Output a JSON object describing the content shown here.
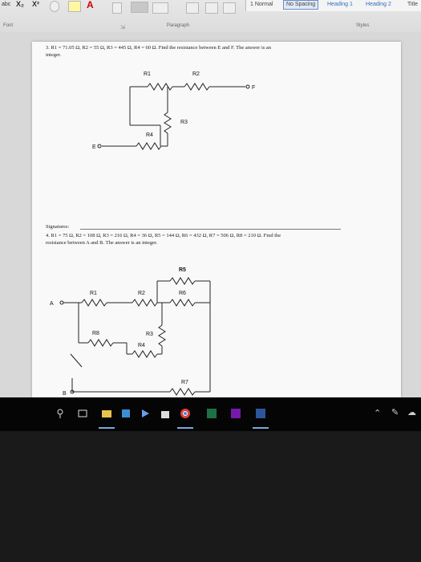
{
  "ribbon": {
    "row_left": [
      "abc",
      "X₂",
      "X²"
    ],
    "font_group": "Font",
    "paragraph_group": "Paragraph",
    "styles_group": "Styles",
    "styles": [
      "1 Normal",
      "No Spacing",
      "Heading 1",
      "Heading 2",
      "Title"
    ]
  },
  "doc": {
    "q3_line1": "3. R1 = 71.05 Ω, R2 = 55 Ω, R3 = 445 Ω, R4 = 60 Ω. Find the resistance between E and F. The answer is an",
    "q3_line2": "integer.",
    "c1": {
      "r1": "R1",
      "r2": "R2",
      "r3": "R3",
      "r4": "R4",
      "e": "E",
      "f": "F"
    },
    "signatures": "Signatures:",
    "q4_line1": "4. R1 = 75 Ω, R2 = 108 Ω, R3 = 216 Ω, R4 = 36 Ω, R5 = 144 Ω, R6 = 432 Ω, R7 = 506 Ω, R8 = 210 Ω. Find the",
    "q4_line2": "resistance between A and B. The answer is an integer.",
    "c2": {
      "r1": "R1",
      "r2": "R2",
      "r3": "R3",
      "r4": "R4",
      "r5": "R5",
      "r6": "R6",
      "r7": "R7",
      "r8": "R8",
      "a": "A",
      "b": "B"
    }
  },
  "side_label": "ent",
  "taskbar": {
    "apps": [
      "search-icon",
      "cortana-icon",
      "file-explorer-icon",
      "store-icon",
      "media-icon",
      "store-bag-icon",
      "chrome-icon",
      "excel-icon",
      "onenote-icon",
      "word-icon"
    ],
    "tray": [
      "chevron-up-icon",
      "pen-icon",
      "cloud-icon"
    ]
  }
}
